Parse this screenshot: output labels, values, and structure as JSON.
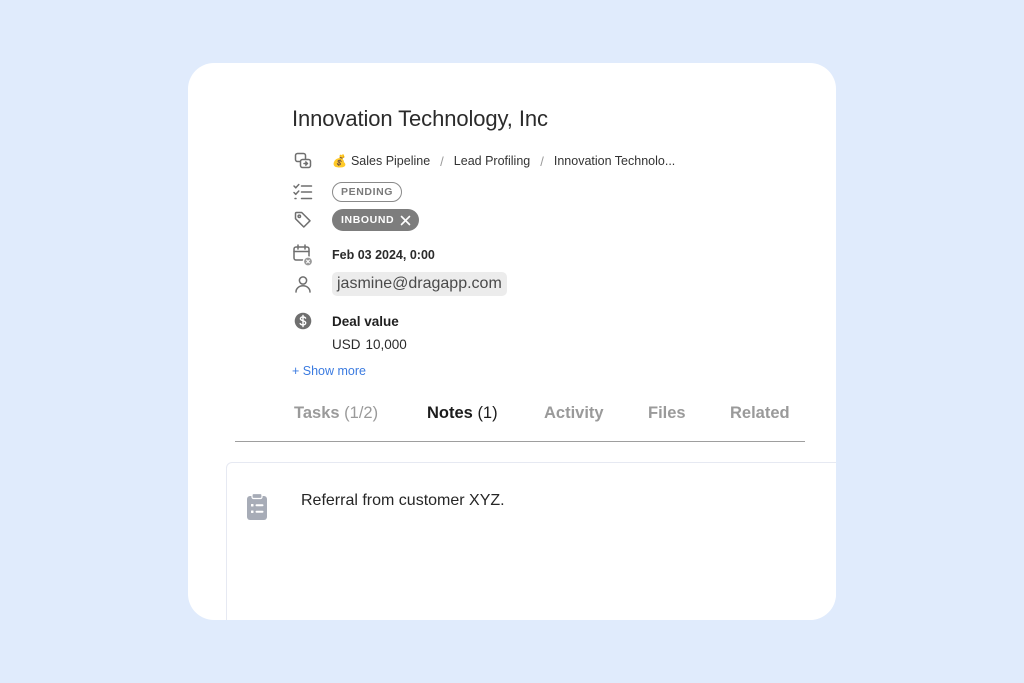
{
  "record": {
    "title": "Innovation Technology, Inc"
  },
  "breadcrumb": {
    "pipeline_emoji": "💰",
    "items": [
      "Sales Pipeline",
      "Lead Profiling",
      "Innovation Technolo..."
    ],
    "separator": "/"
  },
  "status": {
    "label": "PENDING"
  },
  "tags": [
    {
      "label": "INBOUND"
    }
  ],
  "date": {
    "value": "Feb 03 2024, 0:00"
  },
  "assignee": {
    "email": "jasmine@dragapp.com"
  },
  "deal": {
    "label": "Deal value",
    "currency": "USD",
    "amount": "10,000"
  },
  "show_more": {
    "label": "+ Show more"
  },
  "tabs": [
    {
      "label": "Tasks",
      "count": "(1/2)",
      "active": false
    },
    {
      "label": "Notes",
      "count": "(1)",
      "active": true
    },
    {
      "label": "Activity",
      "count": "",
      "active": false
    },
    {
      "label": "Files",
      "count": "",
      "active": false
    },
    {
      "label": "Related",
      "count": "",
      "active": false
    }
  ],
  "notes": [
    {
      "text": "Referral from customer XYZ."
    }
  ],
  "colors": {
    "background": "#e0ebfc",
    "card": "#ffffff",
    "link": "#3b7be0",
    "tag_fill": "#7d7d7d",
    "muted": "#9a9a9a"
  },
  "icons": {
    "breadcrumb": "pipeline-icon",
    "status": "checklist-icon",
    "tags": "tag-icon",
    "date": "calendar-clock-icon",
    "assignee": "user-icon",
    "deal": "dollar-coin-icon",
    "tag_remove": "close-icon",
    "note": "clipboard-list-icon"
  }
}
